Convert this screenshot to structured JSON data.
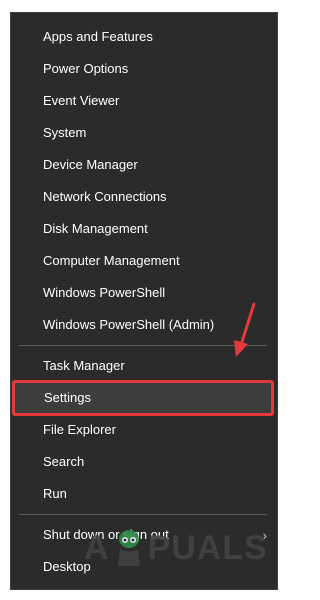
{
  "menu": {
    "items": [
      {
        "label": "Apps and Features"
      },
      {
        "label": "Power Options"
      },
      {
        "label": "Event Viewer"
      },
      {
        "label": "System"
      },
      {
        "label": "Device Manager"
      },
      {
        "label": "Network Connections"
      },
      {
        "label": "Disk Management"
      },
      {
        "label": "Computer Management"
      },
      {
        "label": "Windows PowerShell"
      },
      {
        "label": "Windows PowerShell (Admin)"
      },
      {
        "label": "Task Manager"
      },
      {
        "label": "Settings"
      },
      {
        "label": "File Explorer"
      },
      {
        "label": "Search"
      },
      {
        "label": "Run"
      },
      {
        "label": "Shut down or sign out"
      },
      {
        "label": "Desktop"
      }
    ],
    "submenu_chevron": "›"
  },
  "watermark": {
    "text_left": "A",
    "text_right": "PUALS"
  },
  "colors": {
    "menu_background": "#2b2b2b",
    "highlight_border": "#e33b3b",
    "annotation_arrow": "#e33b3b"
  }
}
